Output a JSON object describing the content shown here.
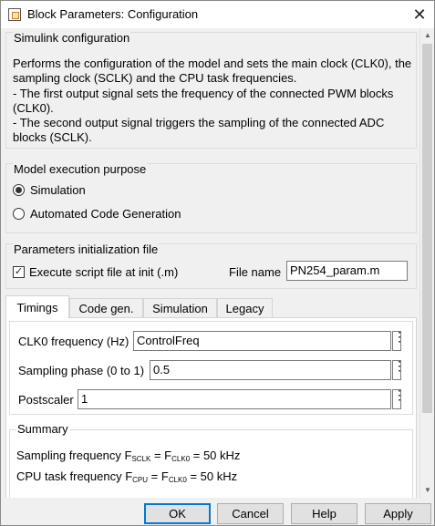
{
  "window": {
    "title": "Block Parameters: Configuration",
    "close_glyph": "✕"
  },
  "simulink_config": {
    "title": "Simulink configuration",
    "description_lines": [
      "Performs the configuration of the model and sets the main clock (CLK0), the",
      "sampling clock (SCLK) and the CPU task frequencies.",
      "- The first output signal sets the frequency of the connected PWM blocks",
      "(CLK0).",
      "- The second output signal triggers the sampling of the connected ADC",
      "blocks (SCLK)."
    ]
  },
  "execution_purpose": {
    "title": "Model execution purpose",
    "options": [
      {
        "label": "Simulation",
        "selected": true
      },
      {
        "label": "Automated Code Generation",
        "selected": false
      }
    ]
  },
  "params_file": {
    "title": "Parameters initialization file",
    "checkbox_label": "Execute script file at init (.m)",
    "checkbox_checked": true,
    "file_name_label": "File name",
    "file_name_value": "PN254_param.m"
  },
  "tabs": [
    {
      "label": "Timings",
      "active": true
    },
    {
      "label": "Code gen.",
      "active": false
    },
    {
      "label": "Simulation",
      "active": false
    },
    {
      "label": "Legacy",
      "active": false
    }
  ],
  "timings": {
    "fields": [
      {
        "label": "CLK0 frequency (Hz)",
        "value": "ControlFreq"
      },
      {
        "label": "Sampling phase (0 to 1)",
        "value": "0.5"
      },
      {
        "label": "Postscaler",
        "value": "1"
      }
    ],
    "more_glyph": "⋮"
  },
  "summary": {
    "title": "Summary",
    "sampling": {
      "prefix": "Sampling frequency F",
      "sub1": "SCLK",
      "middle": " = F",
      "sub2": "CLK0",
      "suffix": " = 50 kHz"
    },
    "cpu": {
      "prefix": "CPU task frequency F",
      "sub1": "CPU",
      "middle": " = F",
      "sub2": "CLK0",
      "suffix": " = 50 kHz"
    }
  },
  "buttons": {
    "ok": "OK",
    "cancel": "Cancel",
    "help": "Help",
    "apply": "Apply"
  },
  "colors": {
    "default_button_border": "#0078d7",
    "window_bg": "#f0f0f0"
  },
  "icons": {
    "app": "block-parameters-icon",
    "close": "close-icon",
    "more": "more-options-icon"
  }
}
